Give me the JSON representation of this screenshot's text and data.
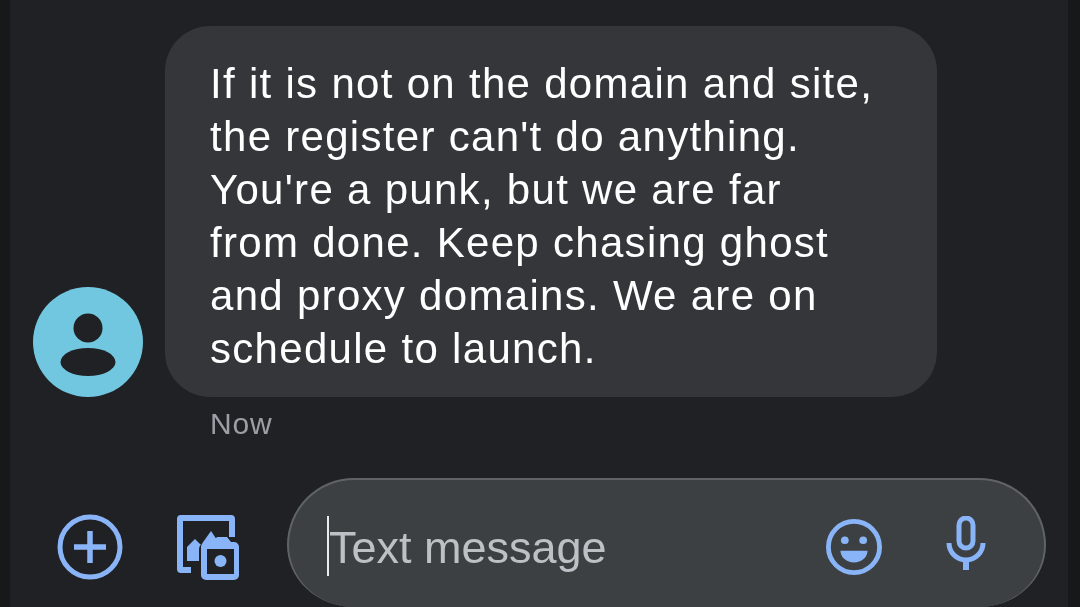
{
  "messages": [
    {
      "text": "If it is not on the domain and site,\nthe register can't do anything.\nYou're a punk, but we are far\nfrom done. Keep chasing ghost\nand proxy domains. We are on\nschedule to launch.",
      "time": "Now"
    }
  ],
  "compose": {
    "placeholder": "Text message",
    "focused": true
  }
}
